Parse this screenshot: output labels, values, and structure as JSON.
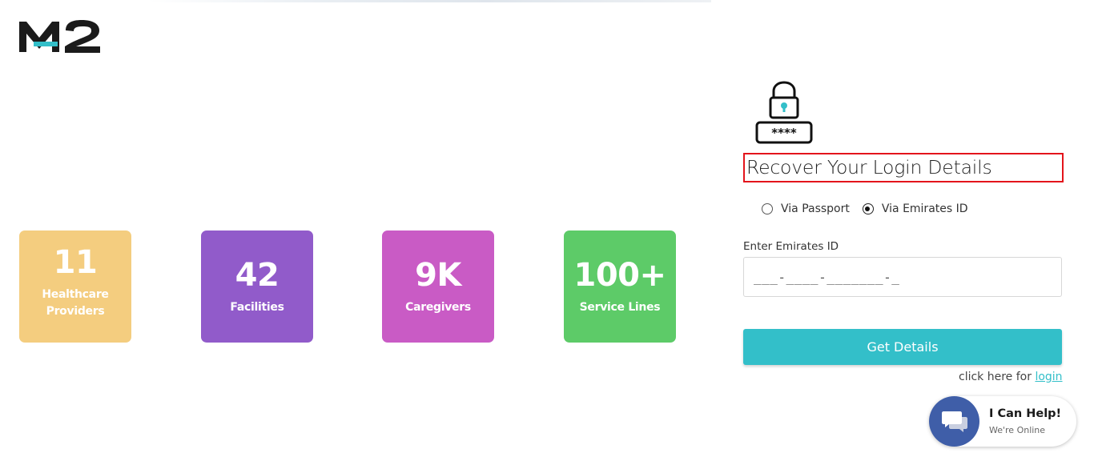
{
  "brand": {
    "logo_text": "M2",
    "accent_color": "#33bfc9"
  },
  "stats": [
    {
      "value": "11",
      "label_line1": "Healthcare",
      "label_line2": "Providers",
      "color": "#f4cd7f"
    },
    {
      "value": "42",
      "label_line1": "Facilities",
      "color": "#915bca"
    },
    {
      "value": "9K",
      "label_line1": "Caregivers",
      "color": "#c95bc5"
    },
    {
      "value": "100+",
      "label_line1": "Service Lines",
      "color": "#5dcb68"
    }
  ],
  "recover": {
    "icon": "lock-password-icon",
    "title": "Recover Your Login Details",
    "options": [
      {
        "label": "Via Passport",
        "checked": false
      },
      {
        "label": "Via Emirates ID",
        "checked": true
      }
    ],
    "field_label": "Enter Emirates ID",
    "field_placeholder": "___-____-_______-_",
    "field_value": "",
    "submit_label": "Get Details",
    "login_hint": "click here for",
    "login_link": "login"
  },
  "chat": {
    "icon": "chat-bubbles-icon",
    "title": "I Can Help!",
    "subtitle": "We're Online"
  }
}
